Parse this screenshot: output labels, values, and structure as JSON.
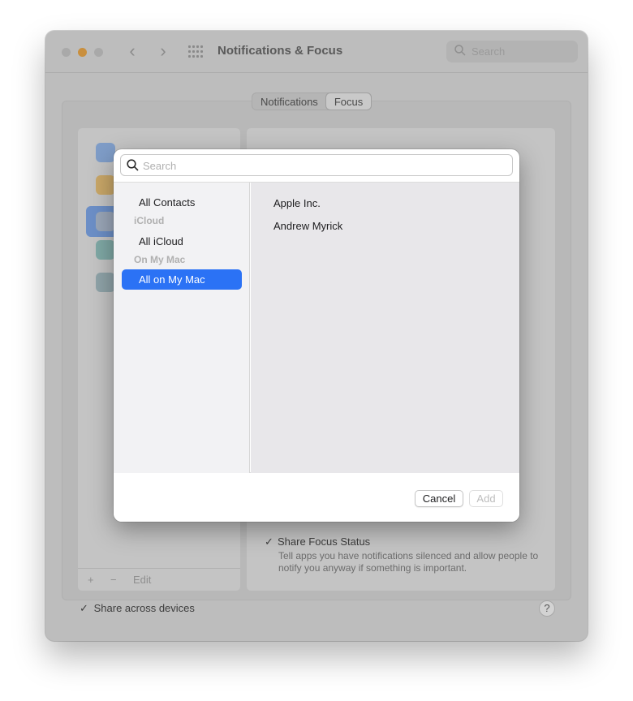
{
  "window": {
    "title": "Notifications & Focus",
    "search_placeholder": "Search"
  },
  "tabs": [
    {
      "label": "Notifications",
      "active": false
    },
    {
      "label": "Focus",
      "active": true
    }
  ],
  "sidebar_footer": {
    "add": "+",
    "remove": "−",
    "edit": "Edit"
  },
  "share_focus": {
    "checked": true,
    "title": "Share Focus Status",
    "description": "Tell apps you have notifications silenced and allow people to notify you anyway if something is important."
  },
  "share_devices": {
    "checked": true,
    "label": "Share across devices"
  },
  "help": "?",
  "sheet": {
    "search_placeholder": "Search",
    "search_value": "",
    "groups": [
      {
        "label": "All Contacts",
        "type": "item",
        "selected": false
      },
      {
        "label": "iCloud",
        "type": "header"
      },
      {
        "label": "All iCloud",
        "type": "item",
        "selected": false
      },
      {
        "label": "On My Mac",
        "type": "header"
      },
      {
        "label": "All on My Mac",
        "type": "item",
        "selected": true
      }
    ],
    "contacts": [
      "Apple Inc.",
      "Andrew Myrick"
    ],
    "cancel_label": "Cancel",
    "add_label": "Add",
    "add_enabled": false
  },
  "colors": {
    "accent": "#2b72f5",
    "window_dim": "#bdbdbd"
  },
  "icons": {
    "sleep": "moon-icon",
    "work": "briefcase-icon",
    "personal": "person-icon",
    "driving": "bed-icon",
    "reading": "contact-card-icon"
  }
}
